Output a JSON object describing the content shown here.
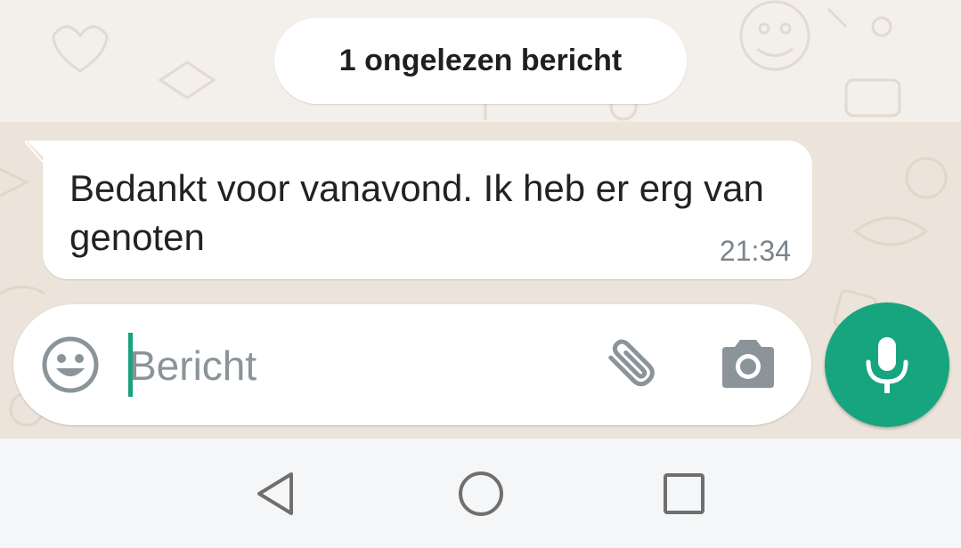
{
  "chat": {
    "unread_label": "1 ongelezen bericht",
    "messages": [
      {
        "text": "Bedankt voor vanavond. Ik heb er erg van genoten",
        "time": "21:34",
        "direction": "incoming"
      }
    ]
  },
  "composer": {
    "placeholder": "Bericht",
    "value": "",
    "icons": {
      "emoji": "smiley-face-icon",
      "attach": "paperclip-icon",
      "camera": "camera-icon",
      "send": "microphone-icon"
    }
  },
  "navigation": {
    "icons": [
      "back-triangle-icon",
      "home-circle-icon",
      "recents-square-icon"
    ]
  },
  "colors": {
    "accent": "#16a57f",
    "caret": "#1aa27d",
    "chat_background": "#ece4da",
    "bubble": "#ffffff",
    "timestamp": "#7a858b",
    "icon_gray": "#8a9499",
    "nav_background": "#f5f6f7"
  }
}
